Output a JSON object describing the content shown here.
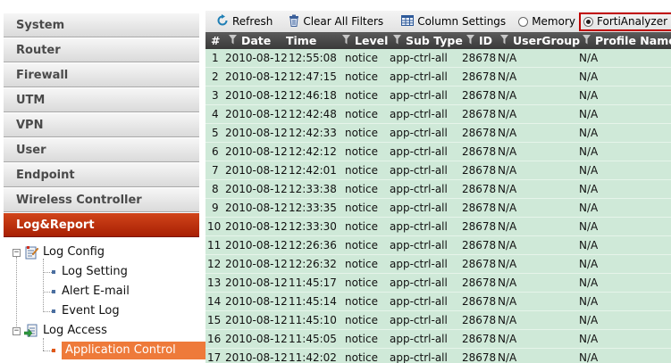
{
  "sidebar": {
    "menu": [
      {
        "label": "System",
        "active": false
      },
      {
        "label": "Router",
        "active": false
      },
      {
        "label": "Firewall",
        "active": false
      },
      {
        "label": "UTM",
        "active": false
      },
      {
        "label": "VPN",
        "active": false
      },
      {
        "label": "User",
        "active": false
      },
      {
        "label": "Endpoint",
        "active": false
      },
      {
        "label": "Wireless Controller",
        "active": false
      },
      {
        "label": "Log&Report",
        "active": true
      }
    ],
    "tree": {
      "log_config": {
        "label": "Log Config",
        "children": [
          "Log Setting",
          "Alert E-mail",
          "Event Log"
        ]
      },
      "log_access": {
        "label": "Log Access",
        "children": [
          "Application Control"
        ]
      }
    }
  },
  "toolbar": {
    "refresh": "Refresh",
    "clear_filters": "Clear All Filters",
    "column_settings": "Column Settings",
    "memory": "Memory",
    "fortianalyzer": "FortiAnalyzer",
    "selected_source": "FortiAnalyzer"
  },
  "table": {
    "columns": [
      "#",
      "Date",
      "Time",
      "Level",
      "Sub Type",
      "ID",
      "UserGroup",
      "Profile Name"
    ],
    "rows": [
      [
        "1",
        "2010-08-12",
        "12:55:08",
        "notice",
        "app-ctrl-all",
        "28678",
        "N/A",
        "N/A"
      ],
      [
        "2",
        "2010-08-12",
        "12:47:15",
        "notice",
        "app-ctrl-all",
        "28678",
        "N/A",
        "N/A"
      ],
      [
        "3",
        "2010-08-12",
        "12:46:18",
        "notice",
        "app-ctrl-all",
        "28678",
        "N/A",
        "N/A"
      ],
      [
        "4",
        "2010-08-12",
        "12:42:48",
        "notice",
        "app-ctrl-all",
        "28678",
        "N/A",
        "N/A"
      ],
      [
        "5",
        "2010-08-12",
        "12:42:33",
        "notice",
        "app-ctrl-all",
        "28678",
        "N/A",
        "N/A"
      ],
      [
        "6",
        "2010-08-12",
        "12:42:12",
        "notice",
        "app-ctrl-all",
        "28678",
        "N/A",
        "N/A"
      ],
      [
        "7",
        "2010-08-12",
        "12:42:01",
        "notice",
        "app-ctrl-all",
        "28678",
        "N/A",
        "N/A"
      ],
      [
        "8",
        "2010-08-12",
        "12:33:38",
        "notice",
        "app-ctrl-all",
        "28678",
        "N/A",
        "N/A"
      ],
      [
        "9",
        "2010-08-12",
        "12:33:35",
        "notice",
        "app-ctrl-all",
        "28678",
        "N/A",
        "N/A"
      ],
      [
        "10",
        "2010-08-12",
        "12:33:30",
        "notice",
        "app-ctrl-all",
        "28678",
        "N/A",
        "N/A"
      ],
      [
        "11",
        "2010-08-12",
        "12:26:36",
        "notice",
        "app-ctrl-all",
        "28678",
        "N/A",
        "N/A"
      ],
      [
        "12",
        "2010-08-12",
        "12:26:32",
        "notice",
        "app-ctrl-all",
        "28678",
        "N/A",
        "N/A"
      ],
      [
        "13",
        "2010-08-12",
        "11:45:17",
        "notice",
        "app-ctrl-all",
        "28678",
        "N/A",
        "N/A"
      ],
      [
        "14",
        "2010-08-12",
        "11:45:14",
        "notice",
        "app-ctrl-all",
        "28678",
        "N/A",
        "N/A"
      ],
      [
        "15",
        "2010-08-12",
        "11:45:10",
        "notice",
        "app-ctrl-all",
        "28678",
        "N/A",
        "N/A"
      ],
      [
        "16",
        "2010-08-12",
        "11:45:05",
        "notice",
        "app-ctrl-all",
        "28678",
        "N/A",
        "N/A"
      ],
      [
        "17",
        "2010-08-12",
        "11:42:02",
        "notice",
        "app-ctrl-all",
        "28678",
        "N/A",
        "N/A"
      ]
    ]
  },
  "colors": {
    "active_menu": "#b52f0c",
    "row_bg": "#cfe9d8",
    "header_bg": "#4a4a4a",
    "selected_leaf": "#ee7a3a",
    "highlight_border": "#c00000"
  }
}
